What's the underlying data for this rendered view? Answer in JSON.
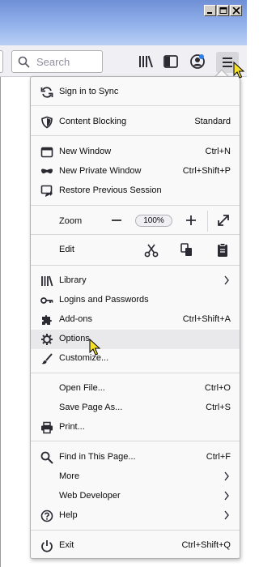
{
  "window_controls": {
    "minimize": "minimize",
    "maximize": "maximize",
    "close": "close"
  },
  "toolbar": {
    "search_placeholder": "Search"
  },
  "menu": {
    "sign_in": "Sign in to Sync",
    "content_blocking": {
      "label": "Content Blocking",
      "value": "Standard"
    },
    "new_window": {
      "label": "New Window",
      "shortcut": "Ctrl+N"
    },
    "new_private_window": {
      "label": "New Private Window",
      "shortcut": "Ctrl+Shift+P"
    },
    "restore_session": "Restore Previous Session",
    "zoom": {
      "label": "Zoom",
      "value": "100%"
    },
    "edit": {
      "label": "Edit"
    },
    "library": "Library",
    "logins": "Logins and Passwords",
    "addons": {
      "label": "Add-ons",
      "shortcut": "Ctrl+Shift+A"
    },
    "options": "Options",
    "customize": "Customize...",
    "open_file": {
      "label": "Open File...",
      "shortcut": "Ctrl+O"
    },
    "save_page": {
      "label": "Save Page As...",
      "shortcut": "Ctrl+S"
    },
    "print": "Print...",
    "find": {
      "label": "Find in This Page...",
      "shortcut": "Ctrl+F"
    },
    "more": "More",
    "web_developer": "Web Developer",
    "help": "Help",
    "exit": {
      "label": "Exit",
      "shortcut": "Ctrl+Shift+Q"
    }
  }
}
